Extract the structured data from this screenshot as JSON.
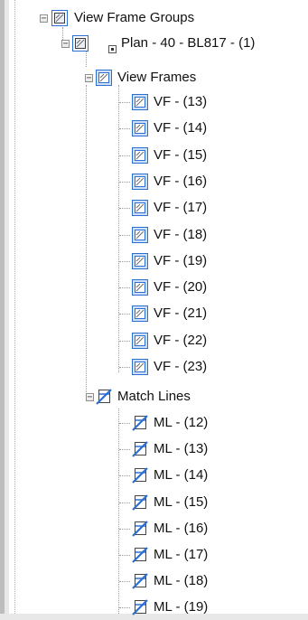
{
  "tree": {
    "root": {
      "label": "View Frame Groups",
      "icon": "view-frame-group-icon"
    },
    "group": {
      "label": "Plan - 40 - BL817 - (1)",
      "icon": "view-frame-group-icon"
    },
    "view_frames": {
      "label": "View Frames",
      "icon": "view-frame-icon",
      "items": [
        "VF - (13)",
        "VF - (14)",
        "VF - (15)",
        "VF - (16)",
        "VF - (17)",
        "VF - (18)",
        "VF - (19)",
        "VF - (20)",
        "VF - (21)",
        "VF - (22)",
        "VF - (23)"
      ]
    },
    "match_lines": {
      "label": "Match Lines",
      "icon": "match-line-icon",
      "items": [
        "ML - (12)",
        "ML - (13)",
        "ML - (14)",
        "ML - (15)",
        "ML - (16)",
        "ML - (17)",
        "ML - (18)",
        "ML - (19)"
      ]
    }
  },
  "colors": {
    "icon_blue": "#2a6fd1",
    "icon_frame": "#3a3a3a"
  }
}
